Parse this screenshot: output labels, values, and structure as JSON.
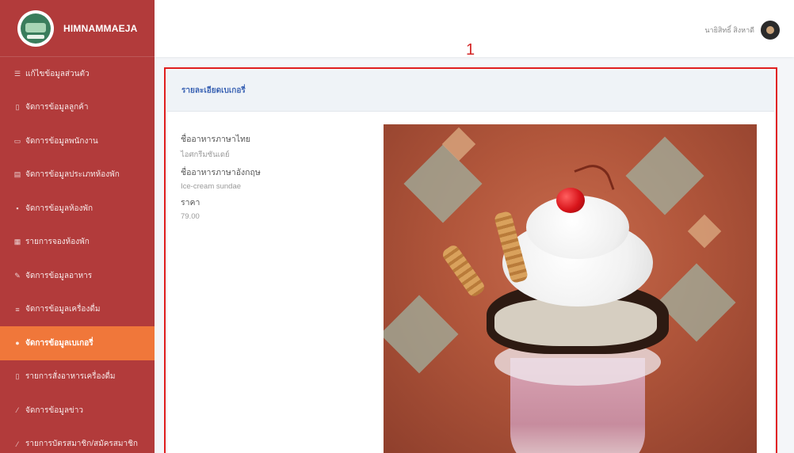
{
  "brand": {
    "name": "HIMNAMMAEJA"
  },
  "sidebar": {
    "items": [
      {
        "label": "แก้ไขข้อมูลส่วนตัว",
        "icon": "user-edit-icon",
        "active": false
      },
      {
        "label": "จัดการข้อมูลลูกค้า",
        "icon": "users-icon",
        "active": false
      },
      {
        "label": "จัดการข้อมูลพนักงาน",
        "icon": "id-card-icon",
        "active": false
      },
      {
        "label": "จัดการข้อมูลประเภทห้องพัก",
        "icon": "list-icon",
        "active": false
      },
      {
        "label": "จัดการข้อมูลห้องพัก",
        "icon": "bed-icon",
        "active": false
      },
      {
        "label": "รายการจองห้องพัก",
        "icon": "calendar-icon",
        "active": false
      },
      {
        "label": "จัดการข้อมูลอาหาร",
        "icon": "food-icon",
        "active": false
      },
      {
        "label": "จัดการข้อมูลเครื่องดื่ม",
        "icon": "drink-icon",
        "active": false
      },
      {
        "label": "จัดการข้อมูลเบเกอรี่",
        "icon": "cake-icon",
        "active": true
      },
      {
        "label": "รายการสั่งอาหารเครื่องดื่ม",
        "icon": "receipt-icon",
        "active": false
      },
      {
        "label": "จัดการข้อมูลข่าว",
        "icon": "pencil-icon",
        "active": false
      },
      {
        "label": "รายการบัตรสมาชิก/สมัครสมาชิก",
        "icon": "pencil-icon",
        "active": false
      }
    ]
  },
  "header": {
    "user_name": "นายิสิทธิ์ สิงหาดี"
  },
  "annotation": {
    "number": "1",
    "color": "#e01e1e"
  },
  "card": {
    "title": "รายละเอียดเบเกอรี่",
    "fields": [
      {
        "label": "ชื่ออาหารภาษาไทย",
        "value": "ไอศกรีมซันเดย์"
      },
      {
        "label": "ชื่ออาหารภาษาอังกฤษ",
        "value": "Ice-cream sundae"
      },
      {
        "label": "ราคา",
        "value": "79.00"
      }
    ],
    "image_alt": "ice-cream-sundae-photo"
  },
  "colors": {
    "sidebar": "#b23b3b",
    "active_item": "#f0773a",
    "link": "#3c64b4"
  }
}
